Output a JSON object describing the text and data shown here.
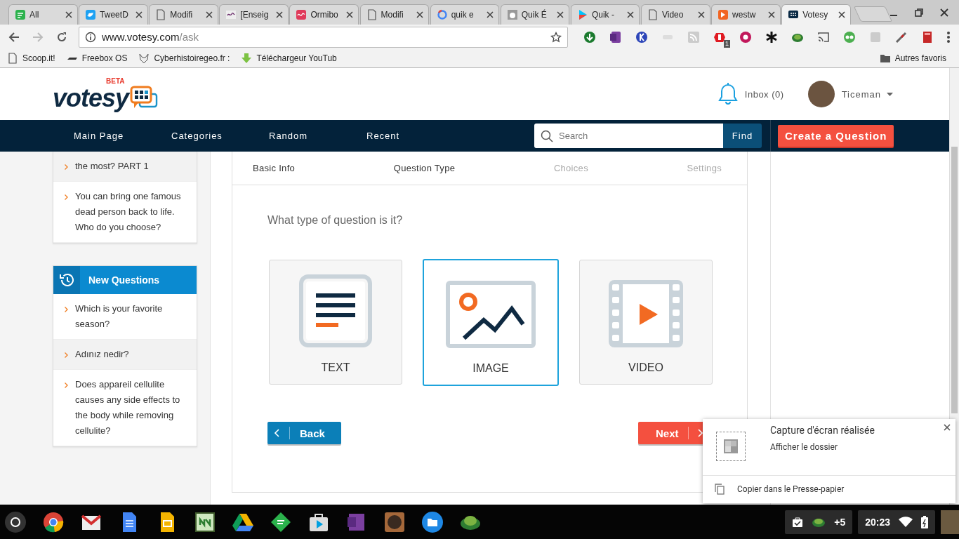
{
  "browser": {
    "tabs": [
      {
        "title": "All",
        "selected": false
      },
      {
        "title": "TweetD",
        "selected": false
      },
      {
        "title": "Modifi",
        "selected": false
      },
      {
        "title": "[Enseig",
        "selected": false
      },
      {
        "title": "Ormibo",
        "selected": false
      },
      {
        "title": "Modifi",
        "selected": false
      },
      {
        "title": "quik e",
        "selected": false
      },
      {
        "title": "Quik É",
        "selected": false
      },
      {
        "title": "Quik -",
        "selected": false
      },
      {
        "title": "Video",
        "selected": false
      },
      {
        "title": "westw",
        "selected": false
      },
      {
        "title": "Votesy",
        "selected": true
      }
    ],
    "address": {
      "domain": "www.votesy.com",
      "path": "/ask"
    },
    "extension_badge": "1",
    "bookmarks": [
      "Scoop.it!",
      "Freebox OS",
      "Cyberhistoiregeo.fr :",
      "Téléchargeur YouTub"
    ],
    "other_bookmarks": "Autres favoris"
  },
  "site": {
    "logo": "votesy",
    "logo_badge": "BETA",
    "inbox": "Inbox (0)",
    "user": "Ticeman",
    "nav": [
      "Main Page",
      "Categories",
      "Random",
      "Recent"
    ],
    "search": {
      "placeholder": "Search",
      "button": "Find"
    },
    "create_button": "Create a Question"
  },
  "sidebar": {
    "popular_items": [
      {
        "text": "the most? PART 1",
        "highlighted": true
      },
      {
        "text": "You can bring one famous dead person back to life. Who do you choose?",
        "highlighted": false
      }
    ],
    "new_questions": {
      "title": "New Questions",
      "items": [
        {
          "text": "Which is your favorite season?",
          "highlighted": false
        },
        {
          "text": "Adınız nedir?",
          "highlighted": true
        },
        {
          "text": "Does appareil cellulite causes any side effects to the body while removing cellulite?",
          "highlighted": false
        }
      ]
    }
  },
  "wizard": {
    "steps": [
      {
        "label": "Basic Info",
        "completed": true
      },
      {
        "label": "Question Type",
        "completed": true
      },
      {
        "label": "Choices",
        "completed": false
      },
      {
        "label": "Settings",
        "completed": false
      }
    ],
    "prompt": "What type of question is it?",
    "options": [
      {
        "label": "TEXT",
        "kind": "text",
        "selected": false
      },
      {
        "label": "IMAGE",
        "kind": "image",
        "selected": true
      },
      {
        "label": "VIDEO",
        "kind": "video",
        "selected": false
      }
    ],
    "back_button": "Back",
    "next_button": "Next"
  },
  "notification": {
    "title": "Capture d'écran réalisée",
    "link": "Afficher le dossier",
    "action": "Copier dans le Presse-papier"
  },
  "shelf": {
    "tray_count": "+5",
    "time": "20:23"
  }
}
